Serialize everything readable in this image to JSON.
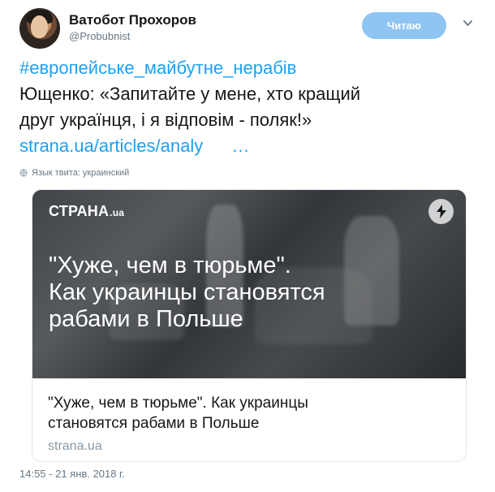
{
  "user": {
    "display_name": "Ватобот Прохоров",
    "username": "@Probubnist",
    "avatar_icon": "person-avatar-icon"
  },
  "actions": {
    "follow_label": "Читаю",
    "more_icon": "chevron-down-icon"
  },
  "tweet": {
    "hashtag": "#европейське_майбутне_нерабів",
    "line1": "Ющенко: «Запитайте у мене, хто кращий",
    "line2": "друг українця, і я відповім - поляк!»",
    "link": "strana.ua/articles/analy",
    "ellipsis": "…"
  },
  "language": {
    "label": "Язык твита: украинский",
    "icon": "globe-icon"
  },
  "card": {
    "brand": "СТРАНА",
    "brand_suffix": ".ua",
    "headline_line1": "\"Хуже, чем в тюрьме\".",
    "headline_line2": "Как украинцы становятся",
    "headline_line3": "рабами в Польше",
    "title_line1": "\"Хуже, чем в тюрьме\". Как украинцы",
    "title_line2": "становятся рабами в Польше",
    "domain": "strana.ua",
    "badge_icon": "lightning-icon"
  },
  "meta": {
    "timestamp": "14:55 - 21 янв. 2018 г."
  },
  "colors": {
    "link": "#1da1f2",
    "follow_button": "#8ec5f2",
    "text": "#14171a",
    "muted": "#657786"
  }
}
